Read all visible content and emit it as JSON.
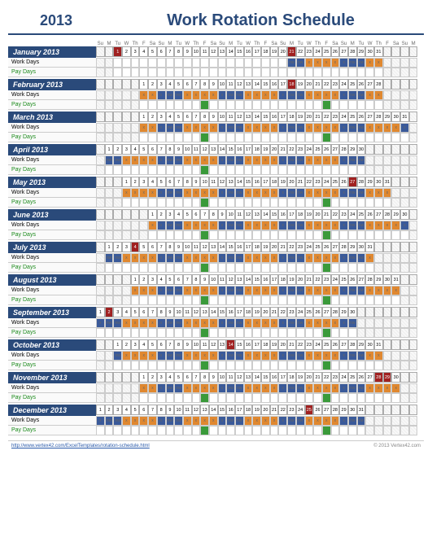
{
  "year": "2013",
  "title": "Work Rotation Schedule",
  "dow": [
    "Su",
    "M",
    "Tu",
    "W",
    "Th",
    "F",
    "Sa",
    "Su",
    "M",
    "Tu",
    "W",
    "Th",
    "F",
    "Sa",
    "Su",
    "M",
    "Tu",
    "W",
    "Th",
    "F",
    "Sa",
    "Su",
    "M",
    "Tu",
    "W",
    "Th",
    "F",
    "Sa",
    "Su",
    "M",
    "Tu",
    "W",
    "Th",
    "F",
    "Sa",
    "Su",
    "M"
  ],
  "labels": {
    "work": "Work Days",
    "pay": "Pay Days"
  },
  "footer": {
    "link": "http://www.vertex42.com/ExcelTemplates/rotation-schedule.html",
    "copy": "© 2013 Vertex42.com"
  },
  "months": [
    {
      "name": "January 2013",
      "pad": 2,
      "len": 31,
      "hol": [
        1,
        21
      ],
      "work": [
        "",
        "",
        "",
        "",
        "",
        "",
        "",
        "",
        "",
        "",
        "",
        "",
        "",
        "",
        "",
        "",
        "",
        "",
        "",
        "",
        "nw",
        "nw",
        "x",
        "x",
        "x",
        "x",
        "x",
        "nw",
        "nw",
        "x",
        "x"
      ],
      "workC": [
        "",
        "",
        "",
        "",
        "",
        "",
        "",
        "",
        "",
        "",
        "",
        "",
        "",
        "",
        "",
        "",
        "",
        "",
        "",
        "",
        "b",
        "b",
        "o",
        "o",
        "o",
        "o",
        "b",
        "b",
        "b",
        "o",
        "o"
      ],
      "pay": [],
      "payC": {}
    },
    {
      "name": "February 2013",
      "pad": 5,
      "len": 28,
      "hol": [
        18
      ],
      "work": [
        "x",
        "x",
        "x",
        "nw",
        "nw",
        "x",
        "x",
        "x",
        "x",
        "x",
        "nw",
        "nw",
        "x",
        "x",
        "x",
        "x",
        "x",
        "nw",
        "nw",
        "x",
        "x",
        "x",
        "x",
        "x",
        "nw",
        "nw",
        "x",
        "x"
      ],
      "workC": [
        "o",
        "o",
        "b",
        "b",
        "b",
        "o",
        "o",
        "o",
        "o",
        "b",
        "b",
        "b",
        "o",
        "o",
        "o",
        "o",
        "b",
        "b",
        "b",
        "o",
        "o",
        "o",
        "o",
        "b",
        "b",
        "b",
        "o",
        "o"
      ],
      "pay": [
        8,
        22
      ],
      "payC": "g"
    },
    {
      "name": "March 2013",
      "pad": 5,
      "len": 31,
      "hol": [],
      "work": [
        "x",
        "x",
        "x",
        "nw",
        "nw",
        "x",
        "x",
        "x",
        "x",
        "x",
        "nw",
        "nw",
        "x",
        "x",
        "x",
        "x",
        "x",
        "nw",
        "nw",
        "x",
        "x",
        "x",
        "x",
        "x",
        "nw",
        "nw",
        "x",
        "x",
        "x",
        "x",
        "x"
      ],
      "workC": [
        "o",
        "o",
        "b",
        "b",
        "b",
        "o",
        "o",
        "o",
        "o",
        "b",
        "b",
        "b",
        "o",
        "o",
        "o",
        "o",
        "b",
        "b",
        "b",
        "o",
        "o",
        "o",
        "o",
        "b",
        "b",
        "b",
        "o",
        "o",
        "o",
        "o",
        "b"
      ],
      "pay": [
        8,
        22
      ],
      "payC": "g"
    },
    {
      "name": "April 2013",
      "pad": 1,
      "len": 30,
      "hol": [],
      "work": [
        "nw",
        "nw",
        "x",
        "x",
        "x",
        "x",
        "x",
        "nw",
        "nw",
        "x",
        "x",
        "x",
        "x",
        "x",
        "nw",
        "nw",
        "x",
        "x",
        "x",
        "x",
        "x",
        "nw",
        "nw",
        "x",
        "x",
        "x",
        "x",
        "x",
        "nw",
        "nw"
      ],
      "workC": [
        "b",
        "b",
        "o",
        "o",
        "o",
        "o",
        "b",
        "b",
        "b",
        "o",
        "o",
        "o",
        "o",
        "b",
        "b",
        "b",
        "o",
        "o",
        "o",
        "o",
        "b",
        "b",
        "b",
        "o",
        "o",
        "o",
        "o",
        "b",
        "b",
        "b"
      ],
      "pay": [
        12
      ],
      "payC": "g"
    },
    {
      "name": "May 2013",
      "pad": 3,
      "len": 31,
      "hol": [
        27
      ],
      "work": [
        "x",
        "x",
        "x",
        "x",
        "x",
        "nw",
        "nw",
        "x",
        "x",
        "x",
        "x",
        "x",
        "nw",
        "nw",
        "x",
        "x",
        "x",
        "x",
        "x",
        "nw",
        "nw",
        "x",
        "x",
        "x",
        "x",
        "x",
        "nw",
        "nw",
        "x",
        "x",
        "x"
      ],
      "workC": [
        "o",
        "o",
        "o",
        "o",
        "b",
        "b",
        "b",
        "o",
        "o",
        "o",
        "o",
        "b",
        "b",
        "b",
        "o",
        "o",
        "o",
        "o",
        "b",
        "b",
        "b",
        "o",
        "o",
        "o",
        "o",
        "b",
        "b",
        "b",
        "o",
        "o",
        "o"
      ],
      "pay": [
        10,
        24
      ],
      "payC": "g"
    },
    {
      "name": "June 2013",
      "pad": 6,
      "len": 30,
      "hol": [],
      "work": [
        "x",
        "x",
        "nw",
        "nw",
        "x",
        "x",
        "x",
        "x",
        "x",
        "nw",
        "nw",
        "x",
        "x",
        "x",
        "x",
        "x",
        "nw",
        "nw",
        "x",
        "x",
        "x",
        "x",
        "x",
        "nw",
        "nw",
        "x",
        "x",
        "x",
        "x",
        "x"
      ],
      "workC": [
        "o",
        "b",
        "b",
        "b",
        "o",
        "o",
        "o",
        "o",
        "b",
        "b",
        "b",
        "o",
        "o",
        "o",
        "o",
        "b",
        "b",
        "b",
        "o",
        "o",
        "o",
        "o",
        "b",
        "b",
        "b",
        "o",
        "o",
        "o",
        "o",
        "b"
      ],
      "pay": [
        7,
        21
      ],
      "payC": "g"
    },
    {
      "name": "July 2013",
      "pad": 1,
      "len": 31,
      "hol": [
        4
      ],
      "work": [
        "nw",
        "nw",
        "x",
        "x",
        "x",
        "x",
        "x",
        "nw",
        "nw",
        "x",
        "x",
        "x",
        "x",
        "x",
        "nw",
        "nw",
        "x",
        "x",
        "x",
        "x",
        "x",
        "nw",
        "nw",
        "x",
        "x",
        "x",
        "x",
        "x",
        "nw",
        "nw",
        "x"
      ],
      "workC": [
        "b",
        "b",
        "o",
        "o",
        "o",
        "o",
        "b",
        "b",
        "b",
        "o",
        "o",
        "o",
        "o",
        "b",
        "b",
        "b",
        "o",
        "o",
        "o",
        "o",
        "b",
        "b",
        "b",
        "o",
        "o",
        "o",
        "o",
        "b",
        "b",
        "b",
        "o"
      ],
      "pay": [
        12,
        26
      ],
      "payC": "g"
    },
    {
      "name": "August 2013",
      "pad": 4,
      "len": 31,
      "hol": [],
      "work": [
        "x",
        "x",
        "x",
        "x",
        "nw",
        "nw",
        "x",
        "x",
        "x",
        "x",
        "x",
        "nw",
        "nw",
        "x",
        "x",
        "x",
        "x",
        "x",
        "nw",
        "nw",
        "x",
        "x",
        "x",
        "x",
        "x",
        "nw",
        "nw",
        "x",
        "x",
        "x",
        "x"
      ],
      "workC": [
        "o",
        "o",
        "o",
        "b",
        "b",
        "b",
        "o",
        "o",
        "o",
        "o",
        "b",
        "b",
        "b",
        "o",
        "o",
        "o",
        "o",
        "b",
        "b",
        "b",
        "o",
        "o",
        "o",
        "o",
        "b",
        "b",
        "b",
        "o",
        "o",
        "o",
        "o"
      ],
      "pay": [
        9,
        23
      ],
      "payC": "g"
    },
    {
      "name": "September 2013",
      "pad": 0,
      "len": 30,
      "hol": [
        2
      ],
      "work": [
        "x",
        "nw",
        "nw",
        "x",
        "x",
        "x",
        "x",
        "x",
        "nw",
        "nw",
        "x",
        "x",
        "x",
        "x",
        "x",
        "nw",
        "nw",
        "x",
        "x",
        "x",
        "x",
        "x",
        "nw",
        "nw",
        "x",
        "x",
        "x",
        "x",
        "x",
        "nw"
      ],
      "workC": [
        "b",
        "b",
        "b",
        "o",
        "o",
        "o",
        "o",
        "b",
        "b",
        "b",
        "o",
        "o",
        "o",
        "o",
        "b",
        "b",
        "b",
        "o",
        "o",
        "o",
        "o",
        "b",
        "b",
        "b",
        "o",
        "o",
        "o",
        "o",
        "b",
        "b"
      ],
      "pay": [
        13,
        27
      ],
      "payC": "g"
    },
    {
      "name": "October 2013",
      "pad": 2,
      "len": 31,
      "hol": [
        14
      ],
      "work": [
        "nw",
        "x",
        "x",
        "x",
        "x",
        "x",
        "nw",
        "nw",
        "x",
        "x",
        "x",
        "x",
        "x",
        "nw",
        "nw",
        "x",
        "x",
        "x",
        "x",
        "x",
        "nw",
        "nw",
        "x",
        "x",
        "x",
        "x",
        "x",
        "nw",
        "nw",
        "x",
        "x"
      ],
      "workC": [
        "b",
        "o",
        "o",
        "o",
        "o",
        "b",
        "b",
        "b",
        "o",
        "o",
        "o",
        "o",
        "b",
        "b",
        "b",
        "o",
        "o",
        "o",
        "o",
        "b",
        "b",
        "b",
        "o",
        "o",
        "o",
        "o",
        "b",
        "b",
        "b",
        "o",
        "o"
      ],
      "pay": [
        11,
        25
      ],
      "payC": "g"
    },
    {
      "name": "November 2013",
      "pad": 5,
      "len": 30,
      "hol": [
        28,
        29
      ],
      "work": [
        "x",
        "x",
        "x",
        "nw",
        "nw",
        "x",
        "x",
        "x",
        "x",
        "x",
        "nw",
        "nw",
        "x",
        "x",
        "x",
        "x",
        "x",
        "nw",
        "nw",
        "x",
        "x",
        "x",
        "x",
        "x",
        "nw",
        "nw",
        "x",
        "x",
        "x",
        "x"
      ],
      "workC": [
        "o",
        "o",
        "b",
        "b",
        "b",
        "o",
        "o",
        "o",
        "o",
        "b",
        "b",
        "b",
        "o",
        "o",
        "o",
        "o",
        "b",
        "b",
        "b",
        "o",
        "o",
        "o",
        "o",
        "b",
        "b",
        "b",
        "o",
        "o",
        "o",
        "o"
      ],
      "pay": [
        8,
        22
      ],
      "payC": "g"
    },
    {
      "name": "December 2013",
      "pad": 0,
      "len": 31,
      "hol": [
        25
      ],
      "work": [
        "x",
        "nw",
        "nw",
        "x",
        "x",
        "x",
        "x",
        "x",
        "nw",
        "nw",
        "x",
        "x",
        "x",
        "x",
        "x",
        "nw",
        "nw",
        "x",
        "x",
        "x",
        "x",
        "x",
        "nw",
        "nw",
        "x",
        "x",
        "x",
        "x",
        "x",
        "nw",
        "nw"
      ],
      "workC": [
        "b",
        "b",
        "b",
        "o",
        "o",
        "o",
        "o",
        "b",
        "b",
        "b",
        "o",
        "o",
        "o",
        "o",
        "b",
        "b",
        "b",
        "o",
        "o",
        "o",
        "o",
        "b",
        "b",
        "b",
        "o",
        "o",
        "o",
        "o",
        "b",
        "b",
        "b"
      ],
      "pay": [
        13,
        27
      ],
      "payC": "g"
    }
  ]
}
